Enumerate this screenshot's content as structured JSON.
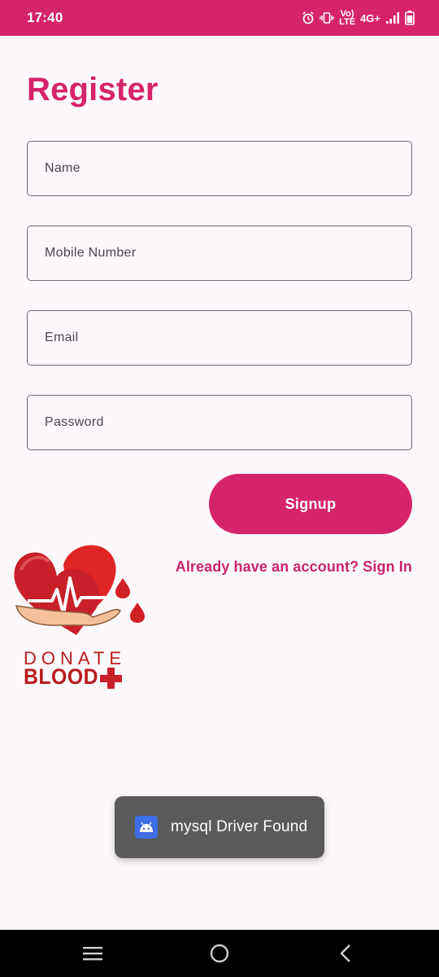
{
  "status_bar": {
    "time": "17:40",
    "network_label": "4G+",
    "volte_top": "Vo)",
    "volte_bottom": "LTE"
  },
  "title": "Register",
  "form": {
    "name_placeholder": "Name",
    "mobile_placeholder": "Mobile Number",
    "email_placeholder": "Email",
    "password_placeholder": "Password",
    "signup_label": "Signup",
    "signin_link": "Already have an account? Sign In"
  },
  "logo": {
    "line1": "DONATE",
    "line2": "BLOOD"
  },
  "toast": {
    "message": "mysql Driver Found",
    "icon": "android-icon"
  },
  "colors": {
    "primary": "#d6246a",
    "logo_red": "#b71c1c",
    "toast_bg": "#5a5a5a"
  }
}
